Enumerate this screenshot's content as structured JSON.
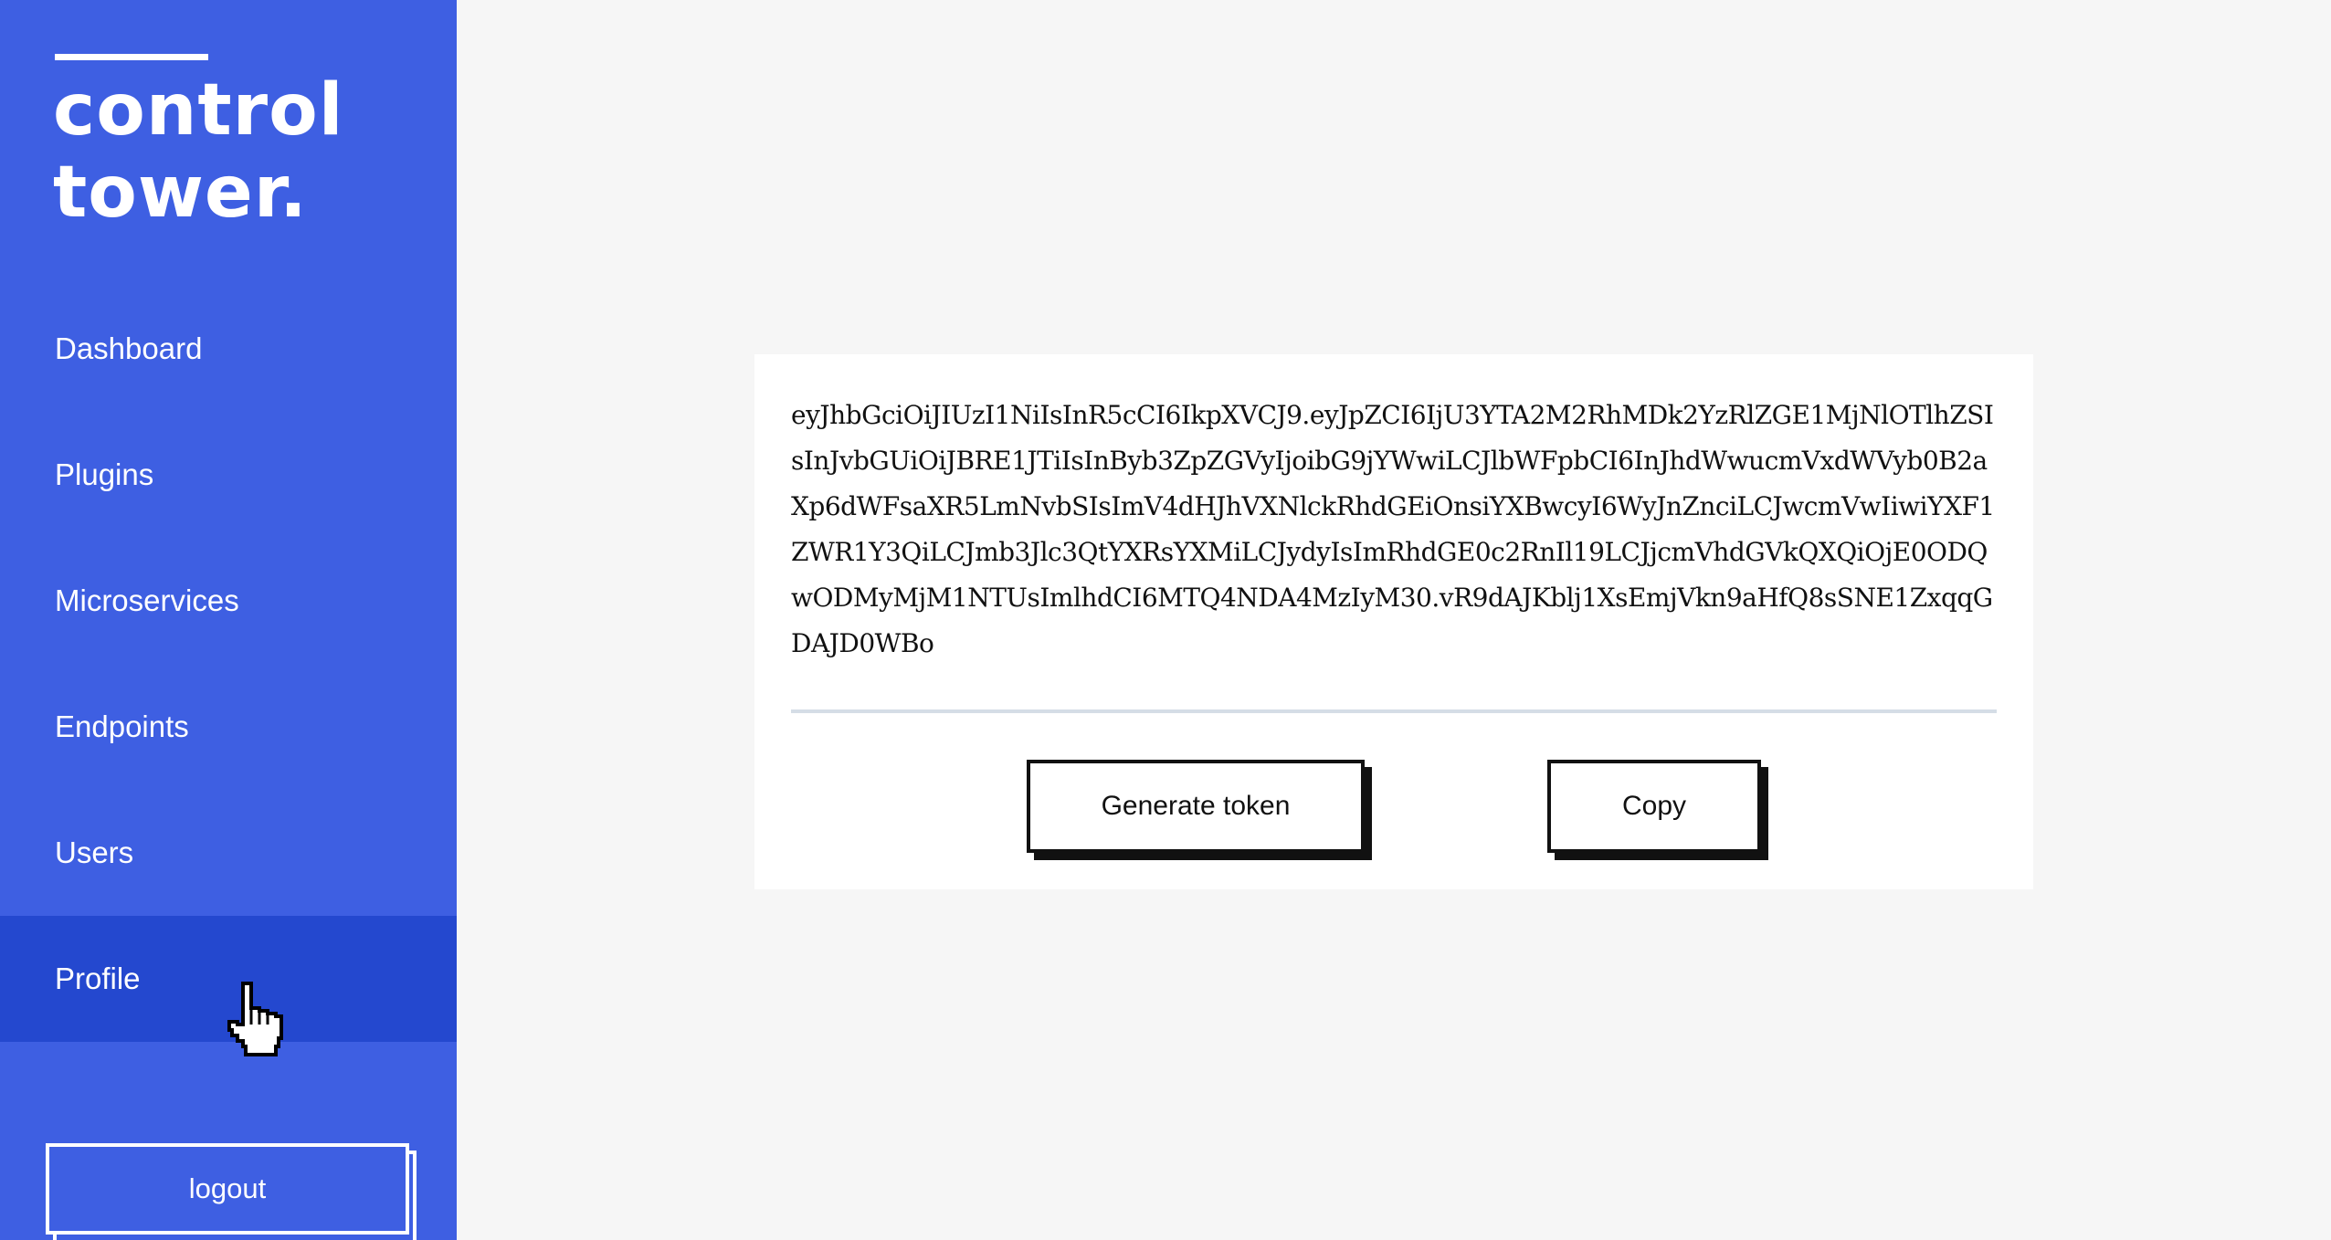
{
  "sidebar": {
    "logo": {
      "line1": "control",
      "line2": "tower."
    },
    "items": [
      {
        "label": "Dashboard"
      },
      {
        "label": "Plugins"
      },
      {
        "label": "Microservices"
      },
      {
        "label": "Endpoints"
      },
      {
        "label": "Users"
      },
      {
        "label": "Profile",
        "active": true
      }
    ],
    "logout_label": "logout"
  },
  "main": {
    "token": "eyJhbGciOiJIUzI1NiIsInR5cCI6IkpXVCJ9.eyJpZCI6IjU3YTA2M2RhMDk2YzRlZGE1MjNlOTlhZSIsInJvbGUiOiJBRE1JTiIsInByb3ZpZGVyIjoibG9jYWwiLCJlbWFpbCI6InJhdWwucmVxdWVyb0B2aXp6dWFsaXR5LmNvbSIsImV4dHJhVXNlckRhdGEiOnsiYXBwcyI6WyJnZnciLCJwcmVwIiwiYXF1ZWR1Y3QiLCJmb3Jlc3QtYXRsYXMiLCJydyIsImRhdGE0c2RnIl19LCJjcmVhdGVkQXQiOjE0ODQwODMyMjM1NTUsImlhdCI6MTQ4NDA4MzIyM30.vR9dAJKblj1XsEmjVkn9aHfQ8sSNE1ZxqqGDAJD0WBo",
    "generate_label": "Generate token",
    "copy_label": "Copy"
  },
  "icons": {
    "cursor": "hand-pointer-icon"
  },
  "colors": {
    "sidebar_bg": "#3e5fe2",
    "sidebar_active_bg": "#2448cf",
    "main_bg": "#f6f6f6",
    "card_bg": "#ffffff"
  }
}
